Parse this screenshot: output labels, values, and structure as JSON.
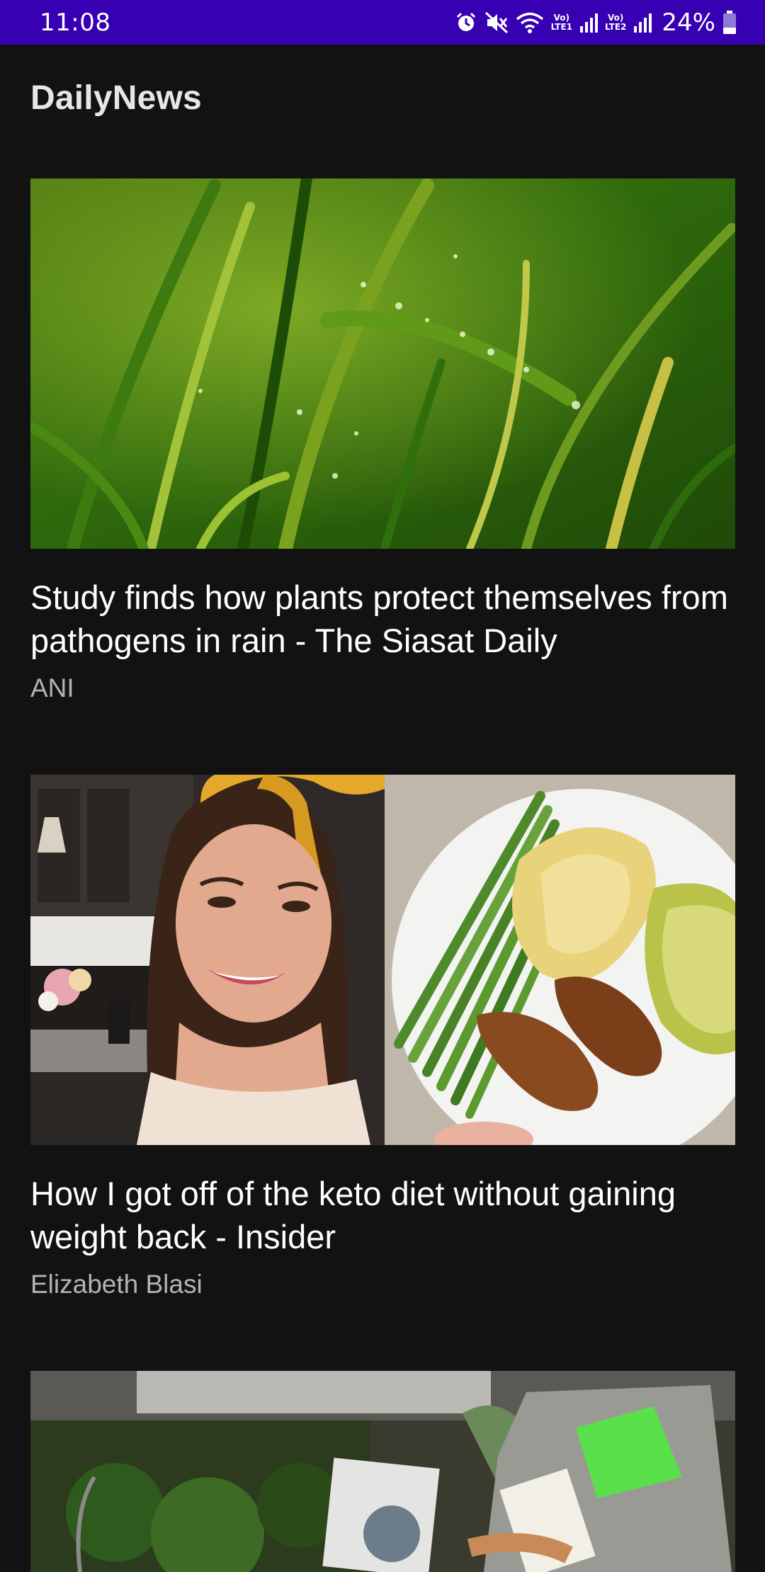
{
  "status_bar": {
    "time": "11:08",
    "network_1": {
      "top": "Vo)",
      "bottom": "LTE1"
    },
    "network_2": {
      "top": "Vo)",
      "bottom": "LTE2"
    },
    "battery": "24%"
  },
  "app": {
    "title": "DailyNews"
  },
  "articles": [
    {
      "headline": "Study finds how plants protect themselves from pathogens in rain - The Siasat Daily",
      "source": "ANI",
      "image": "grass-with-raindrops"
    },
    {
      "headline": "How I got off of the keto diet without gaining weight back - Insider",
      "source": "Elizabeth Blasi",
      "image": "woman-selfie-and-keto-plate"
    },
    {
      "headline": "",
      "source": "",
      "image": "person-inspecting-garden"
    }
  ],
  "colors": {
    "status_bar": "#3700b3",
    "background": "#121212",
    "headline": "#ffffff",
    "source": "#b3b3b3"
  }
}
